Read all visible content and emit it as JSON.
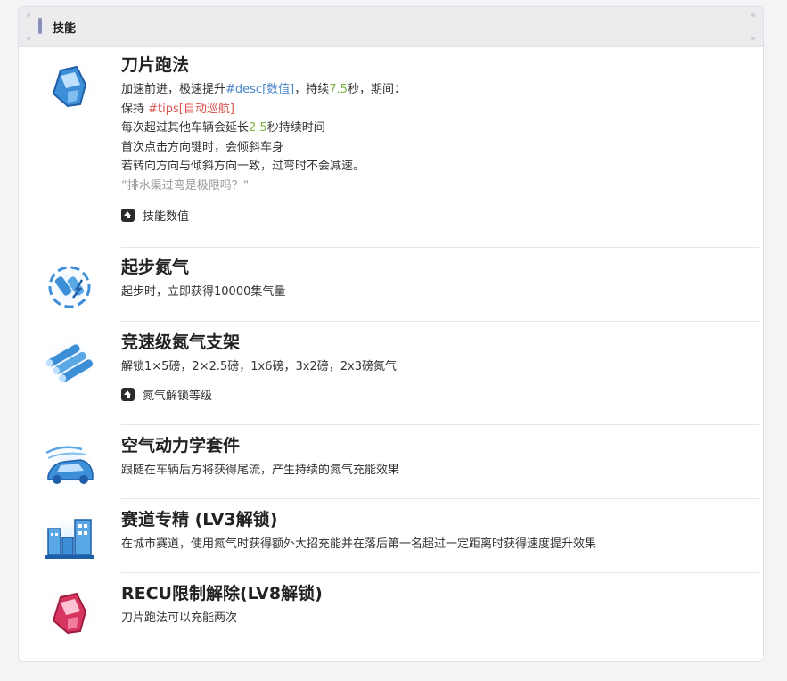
{
  "header": {
    "title": "技能"
  },
  "skills": [
    {
      "name": "刀片跑法",
      "desc": {
        "l1": {
          "pre": "加速前进，极速提升",
          "tag": "#desc[数值]",
          "mid": "，持续",
          "num": "7.5",
          "post": "秒，期间："
        },
        "l2": {
          "pre": "保持 ",
          "tag": "#tips[自动巡航]"
        },
        "l3": {
          "pre": "每次超过其他车辆会延长",
          "num": "2.5",
          "post": "秒持续时间"
        },
        "l4": "首次点击方向键时，会倾斜车身",
        "l5": "若转向方向与倾斜方向一致，过弯时不会减速。",
        "l6": "“排水渠过弯是极限吗？“"
      },
      "toggle": "技能数值",
      "icon": "blade-car-icon",
      "color": "#3c8fd6"
    },
    {
      "name": "起步氮气",
      "desc": "起步时，立即获得10000集气量",
      "icon": "nitro-start-icon",
      "color": "#3c8fd6"
    },
    {
      "name": "竞速级氮气支架",
      "desc": "解锁1×5磅，2×2.5磅，1x6磅，3x2磅，2x3磅氮气",
      "toggle": "氮气解锁等级",
      "icon": "nitro-rack-icon",
      "color": "#3c8fd6"
    },
    {
      "name": "空气动力学套件",
      "desc": "跟随在车辆后方将获得尾流，产生持续的氮气充能效果",
      "icon": "aero-kit-icon",
      "color": "#3c8fd6"
    },
    {
      "name": "赛道专精 (LV3解锁)",
      "desc": "在城市赛道，使用氮气时获得额外大招充能并在落后第一名超过一定距离时获得速度提升效果",
      "icon": "city-track-icon",
      "color": "#3c8fd6"
    },
    {
      "name": "RECU限制解除(LV8解锁)",
      "desc": "刀片跑法可以充能两次",
      "icon": "recu-car-icon",
      "color": "#d6355f"
    }
  ]
}
